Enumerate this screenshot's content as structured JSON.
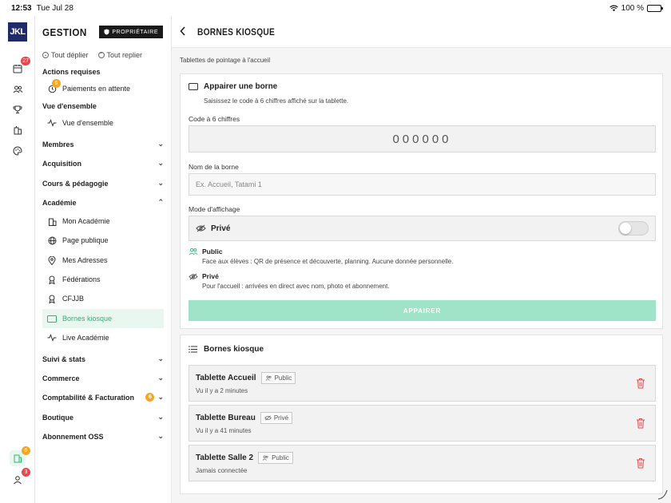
{
  "status_bar": {
    "time": "12:53",
    "date": "Tue Jul 28",
    "battery": "100 %"
  },
  "rail": {
    "logo": "JKL",
    "items": [
      {
        "icon": "calendar-icon",
        "badge": "27"
      },
      {
        "icon": "users-icon",
        "badge": ""
      },
      {
        "icon": "trophy-icon",
        "badge": ""
      },
      {
        "icon": "building-icon",
        "badge": ""
      },
      {
        "icon": "palette-icon",
        "badge": ""
      }
    ],
    "bottom": [
      {
        "icon": "kiosk-icon",
        "badge": "6"
      },
      {
        "icon": "profile-icon",
        "badge": "3"
      }
    ]
  },
  "sidebar": {
    "title": "GESTION",
    "owner_badge": "PROPRIÉTAIRE",
    "expand_all": "Tout déplier",
    "collapse_all": "Tout replier",
    "required_actions": "Actions requises",
    "pending_payments": "Paiements en attente",
    "pending_badge": "6",
    "overview_section": "Vue d'ensemble",
    "overview_item": "Vue d'ensemble",
    "groups": {
      "members": "Membres",
      "acquisition": "Acquisition",
      "courses": "Cours & pédagogie",
      "academy": "Académie",
      "stats": "Suivi & stats",
      "commerce": "Commerce",
      "accounting": "Comptabilité & Facturation",
      "shop": "Boutique",
      "subscription": "Abonnement OSS"
    },
    "accounting_badge": "6",
    "academy_items": [
      "Mon Académie",
      "Page publique",
      "Mes Adresses",
      "Fédérations",
      "CFJJB",
      "Bornes kiosque",
      "Live Académie"
    ]
  },
  "main": {
    "title": "BORNES KIOSQUE",
    "breadcrumb": "Tablettes de pointage à l'accueil",
    "pair": {
      "title": "Appairer une borne",
      "subtitle": "Saisissez le code à 6 chiffres affiché sur la tablette.",
      "code_label": "Code à 6 chiffres",
      "code_placeholder": "000000",
      "name_label": "Nom de la borne",
      "name_placeholder": "Ex. Accueil, Tatami 1",
      "mode_label": "Mode d'affichage",
      "mode_value": "Privé",
      "mode_toggle_on": false,
      "public_title": "Public",
      "public_desc": "Face aux élèves : QR de présence et découverte, planning. Aucune donnée personnelle.",
      "private_title": "Privé",
      "private_desc": "Pour l'accueil : arrivées en direct avec nom, photo et abonnement.",
      "button": "APPAIRER"
    },
    "list": {
      "title": "Bornes kiosque",
      "items": [
        {
          "name": "Tablette Accueil",
          "mode": "Public",
          "seen": "Vu il y a 2 minutes"
        },
        {
          "name": "Tablette Bureau",
          "mode": "Privé",
          "seen": "Vu il y a 41 minutes"
        },
        {
          "name": "Tablette Salle 2",
          "mode": "Public",
          "seen": "Jamais connectée"
        }
      ]
    }
  },
  "colors": {
    "accent": "#2bb673",
    "accent_light": "#9fe3c9",
    "danger": "#e5484d",
    "warning": "#f5a623",
    "brand": "#1f2a6b"
  }
}
